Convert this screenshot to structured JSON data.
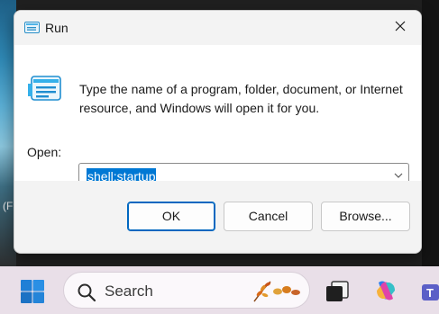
{
  "desktop": {
    "edge_text": "(F"
  },
  "dialog": {
    "title": "Run",
    "description": "Type the name of a program, folder, document, or Internet resource, and Windows will open it for you.",
    "open_label": "Open:",
    "command_value": "shell:startup",
    "buttons": {
      "ok": "OK",
      "cancel": "Cancel",
      "browse": "Browse..."
    }
  },
  "taskbar": {
    "search_placeholder": "Search"
  },
  "colors": {
    "accent": "#0067c0",
    "selection": "#0078d4",
    "taskbar": "#e9dfe8"
  }
}
